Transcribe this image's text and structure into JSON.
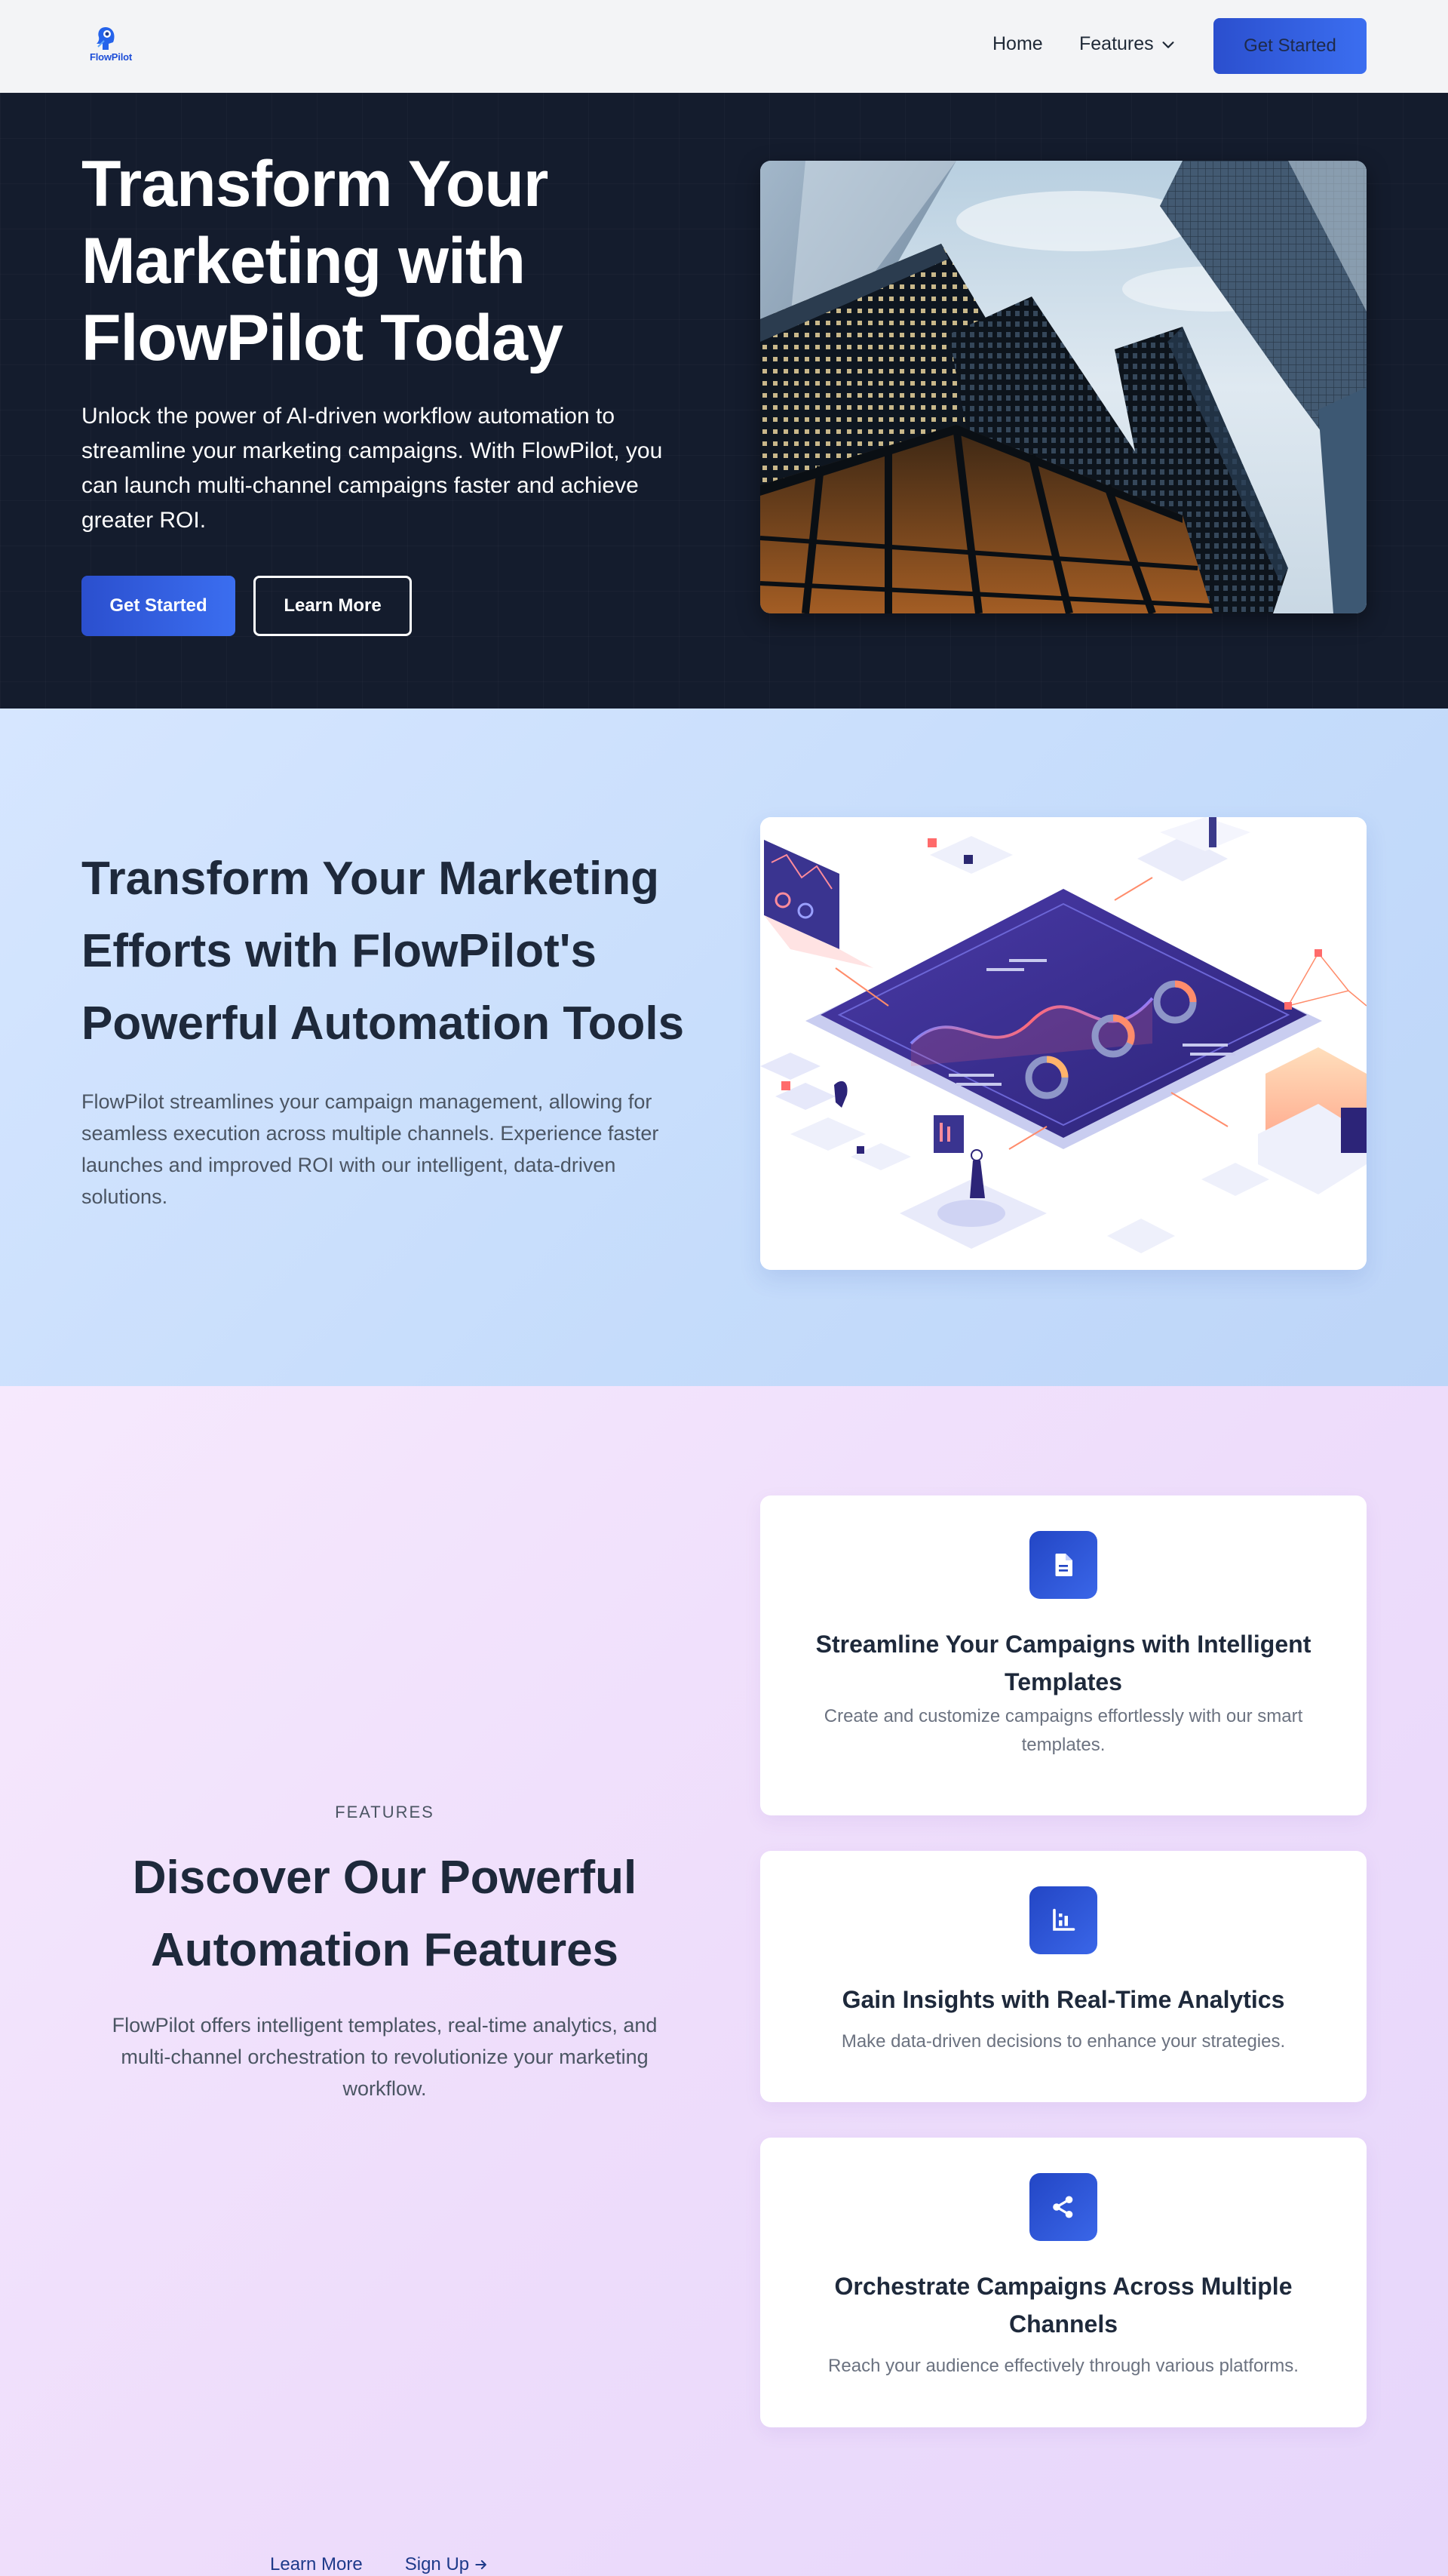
{
  "nav": {
    "logo_text": "FlowPilot",
    "home": "Home",
    "features": "Features",
    "cta": "Get Started"
  },
  "hero": {
    "title": "Transform Your Marketing with FlowPilot Today",
    "subtitle": "Unlock the power of AI-driven workflow automation to streamline your marketing campaigns. With FlowPilot, you can launch multi-channel campaigns faster and achieve greater ROI.",
    "primary_button": "Get Started",
    "secondary_button": "Learn More"
  },
  "section2": {
    "title": "Transform Your Marketing Efforts with FlowPilot's Powerful Automation Tools",
    "text": "FlowPilot streamlines your campaign management, allowing for seamless execution across multiple channels. Experience faster launches and improved ROI with our intelligent, data-driven solutions."
  },
  "features": {
    "label": "FEATURES",
    "title": "Discover Our Powerful Automation Features",
    "text": "FlowPilot offers intelligent templates, real-time analytics, and multi-channel orchestration to revolutionize your marketing workflow.",
    "cards": [
      {
        "icon": "document-icon",
        "title": "Streamline Your Campaigns with Intelligent Templates",
        "desc": "Create and customize campaigns effortlessly with our smart templates."
      },
      {
        "icon": "chart-icon",
        "title": "Gain Insights with Real-Time Analytics",
        "desc": "Make data-driven decisions to enhance your strategies."
      },
      {
        "icon": "share-icon",
        "title": "Orchestrate Campaigns Across Multiple Channels",
        "desc": "Reach your audience effectively through various platforms."
      }
    ],
    "links": {
      "learn_more": "Learn More",
      "sign_up": "Sign Up"
    }
  },
  "colors": {
    "accent": "#2b4fce",
    "hero_bg": "#141c2d",
    "text_dark": "#1e293b"
  }
}
